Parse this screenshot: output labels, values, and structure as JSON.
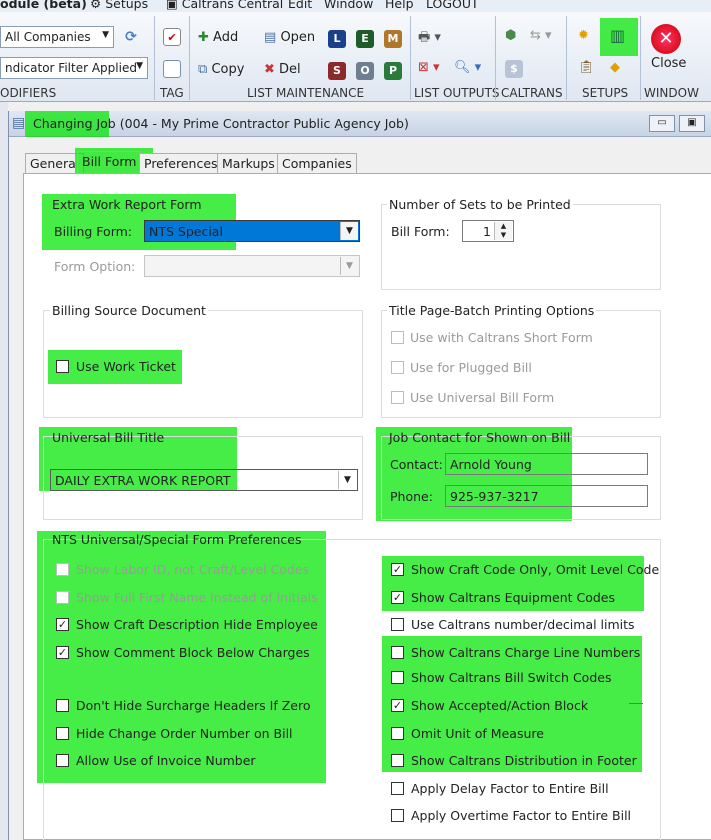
{
  "menubar": {
    "items": [
      "odule (beta)",
      "Setups",
      "Caltrans Central",
      "Edit",
      "Window",
      "Help",
      "LOGOUT"
    ]
  },
  "ribbon": {
    "companies_combo": "All Companies",
    "filter_combo": "ndicator Filter Applied",
    "groups": {
      "modifiers": "ODIFIERS",
      "tag": "TAG",
      "list_maintenance": "LIST MAINTENANCE",
      "list_outputs": "LIST OUTPUTS",
      "caltrans": "CALTRANS",
      "setups": "SETUPS",
      "window": "WINDOW"
    },
    "buttons": {
      "add": "Add",
      "open": "Open",
      "copy": "Copy",
      "del": "Del",
      "close": "Close"
    },
    "letter_icons": [
      "L",
      "E",
      "M",
      "S",
      "O",
      "P"
    ]
  },
  "window": {
    "title_prefix": "Changing Job",
    "title_suffix": "(004 - My Prime Contractor Public Agency Job)",
    "tabs": [
      "General",
      "Bill Form",
      "Preferences",
      "Markups",
      "Companies"
    ],
    "active_tab": "Bill Form"
  },
  "extra_work": {
    "title": "Extra Work Report Form",
    "billing_form_label": "Billing Form:",
    "billing_form_value": "NTS Special",
    "form_option_label": "Form Option:",
    "form_option_value": ""
  },
  "sets": {
    "title": "Number of Sets to be Printed",
    "bill_form_label": "Bill Form:",
    "bill_form_value": "1"
  },
  "billing_source": {
    "title": "Billing Source Document",
    "use_work_ticket": "Use Work Ticket"
  },
  "title_page": {
    "title": "Title Page-Batch Printing Options",
    "options": [
      "Use with Caltrans Short Form",
      "Use for Plugged Bill",
      "Use Universal Bill Form"
    ]
  },
  "universal_bill": {
    "title": "Universal Bill Title",
    "value": "DAILY EXTRA WORK REPORT"
  },
  "job_contact": {
    "title": "Job Contact for Shown on Bill",
    "contact_label": "Contact:",
    "contact_value": "Arnold Young",
    "phone_label": "Phone:",
    "phone_value": "925-937-3217"
  },
  "nts_prefs": {
    "title": "NTS Universal/Special Form Preferences",
    "left": [
      {
        "label": "Show Labor ID, not Craft/Level Codes",
        "checked": false,
        "disabled": true
      },
      {
        "label": "Show Full First Name Instead of Initials",
        "checked": false,
        "disabled": true
      },
      {
        "label": "Show Craft Description Hide Employee",
        "checked": true,
        "disabled": false
      },
      {
        "label": "Show Comment Block Below Charges",
        "checked": true,
        "disabled": false
      },
      {
        "label": "Don't Hide Surcharge Headers If Zero",
        "checked": false,
        "disabled": false
      },
      {
        "label": "Hide Change Order Number on Bill",
        "checked": false,
        "disabled": false
      },
      {
        "label": "Allow Use of Invoice Number",
        "checked": false,
        "disabled": false
      }
    ],
    "right": [
      {
        "label": "Show Craft Code Only, Omit Level Code",
        "checked": true
      },
      {
        "label": "Show Caltrans Equipment Codes",
        "checked": true
      },
      {
        "label": "Use Caltrans number/decimal limits",
        "checked": false
      },
      {
        "label": "Show Caltrans Charge Line Numbers",
        "checked": false
      },
      {
        "label": "Show Caltrans Bill Switch Codes",
        "checked": false
      },
      {
        "label": "Show Accepted/Action Block",
        "checked": true
      },
      {
        "label": "Omit Unit of Measure",
        "checked": false
      },
      {
        "label": "Show Caltrans Distribution in Footer",
        "checked": false
      },
      {
        "label": "Apply Delay Factor to Entire Bill",
        "checked": false
      },
      {
        "label": "Apply Overtime Factor to Entire Bill",
        "checked": false
      }
    ]
  },
  "colors": {
    "highlight": "#00e600",
    "selection_blue": "#0078d7",
    "ribbon_bg": "#dfe7f2"
  }
}
